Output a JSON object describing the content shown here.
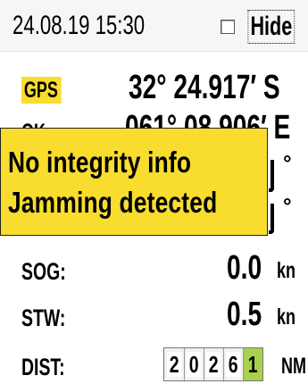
{
  "header": {
    "datetime": "24.08.19  15:30",
    "hide_label": "Hide",
    "hide_checked": false
  },
  "position": {
    "gps_label": "GPS",
    "latitude": "32° 24.917′ S",
    "lon_label": "OK",
    "longitude": "061° 08.906′ E"
  },
  "warning": {
    "line1": "No integrity info",
    "line2": "Jamming detected",
    "color": "#f8dc2e"
  },
  "motion": {
    "hidden_symbol_1": "°",
    "hidden_symbol_2": "°",
    "sog_label": "SOG:",
    "sog_value": "0.0",
    "sog_unit": "kn",
    "stw_label": "STW:",
    "stw_value": "0.5",
    "stw_unit": "kn"
  },
  "distance": {
    "label": "DIST:",
    "digits": [
      "2",
      "0",
      "2",
      "6",
      "1"
    ],
    "unit": "NM",
    "rolling_digit_color": "#a8d24e"
  }
}
